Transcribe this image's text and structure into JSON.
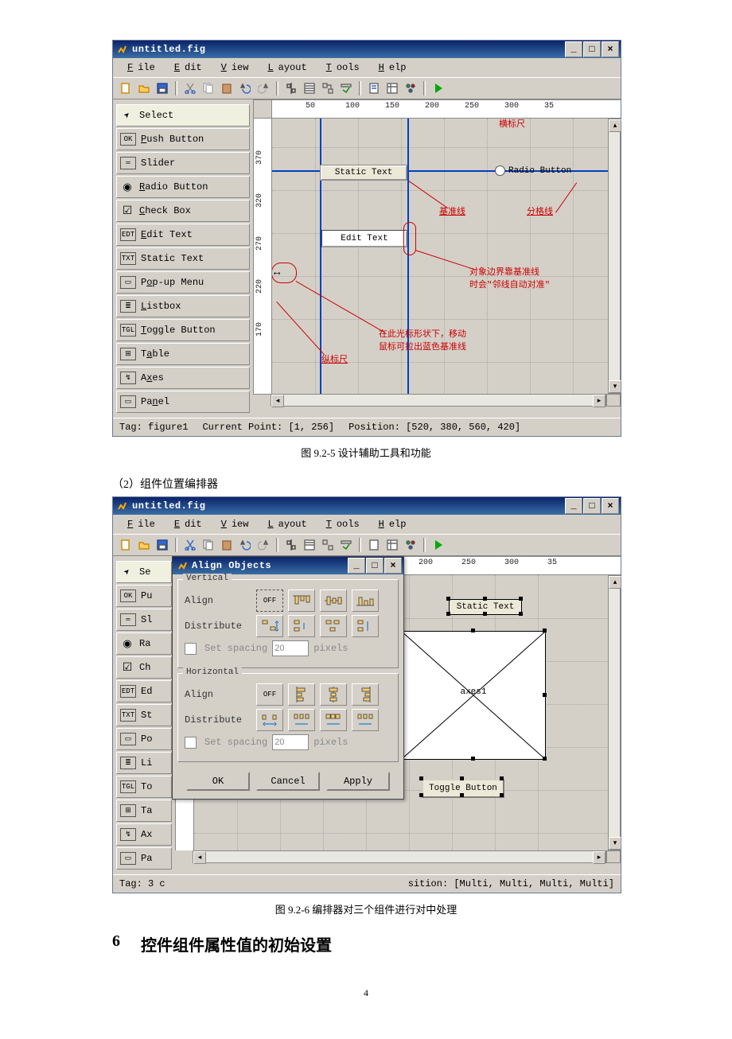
{
  "window": {
    "title": "untitled.fig",
    "menus": [
      "File",
      "Edit",
      "View",
      "Layout",
      "Tools",
      "Help"
    ],
    "ruler_top": [
      "50",
      "100",
      "150",
      "200",
      "250",
      "300",
      "35"
    ],
    "ruler_left": [
      "370",
      "320",
      "270",
      "220",
      "170"
    ]
  },
  "palette": {
    "items": [
      {
        "icon": "▲",
        "label": "Select",
        "u": null,
        "sel": true
      },
      {
        "icon": "OK",
        "label": "Push Button",
        "u": "P"
      },
      {
        "icon": "═",
        "label": "Slider",
        "u": null
      },
      {
        "icon": "◉",
        "label": "Radio Button",
        "u": "R"
      },
      {
        "icon": "☑",
        "label": "Check Box",
        "u": "C"
      },
      {
        "icon": "EDT",
        "label": "Edit Text",
        "u": "E"
      },
      {
        "icon": "TXT",
        "label": "Static Text",
        "u": null
      },
      {
        "icon": "▭",
        "label": "Pop-up Menu",
        "u": "o"
      },
      {
        "icon": "≣",
        "label": "Listbox",
        "u": "L"
      },
      {
        "icon": "TGL",
        "label": "Toggle Button",
        "u": "T"
      },
      {
        "icon": "⊞",
        "label": "Table",
        "u": "a"
      },
      {
        "icon": "↯",
        "label": "Axes",
        "u": "x"
      },
      {
        "icon": "▭",
        "label": "Panel",
        "u": "n"
      }
    ]
  },
  "canvas1": {
    "static_text": "Static Text",
    "radio_button": "Radio Button",
    "edit_text": "Edit Text",
    "annot": {
      "hruler": "横标尺",
      "guide": "基准线",
      "gridline": "分格线",
      "snap1": "对象边界靠基准线",
      "snap2": "时会\"邻线自动对准\"",
      "drag1": "在此光标形状下，移动",
      "drag2": "鼠标可拉出蓝色基准线",
      "vruler": "纵标尺"
    }
  },
  "status1": {
    "tag_label": "Tag:",
    "tag_value": "figure1",
    "cp_label": "Current Point:",
    "cp_value": "[1, 256]",
    "pos_label": "Position:",
    "pos_value": "[520, 380, 560, 420]"
  },
  "caption1": "图 9.2-5  设计辅助工具和功能",
  "section2": "（2）组件位置编排器",
  "dialog": {
    "title": "Align Objects",
    "vertical": "Vertical",
    "horizontal": "Horizontal",
    "align": "Align",
    "distribute": "Distribute",
    "off": "OFF",
    "set_spacing": "Set spacing",
    "spacing_val": "20",
    "pixels": "pixels",
    "ok": "OK",
    "cancel": "Cancel",
    "apply": "Apply"
  },
  "canvas2": {
    "static_text": "Static Text",
    "axes": "axes1",
    "toggle": "Toggle Button"
  },
  "status2": {
    "tag_label": "Tag:",
    "tag_value": "3 c",
    "pos_label": "sition:",
    "pos_value": "[Multi, Multi, Multi, Multi]"
  },
  "caption2": "图 9.2-6  编排器对三个组件进行对中处理",
  "heading": {
    "num": "6",
    "text": "控件组件属性值的初始设置"
  },
  "pagenum": "4"
}
